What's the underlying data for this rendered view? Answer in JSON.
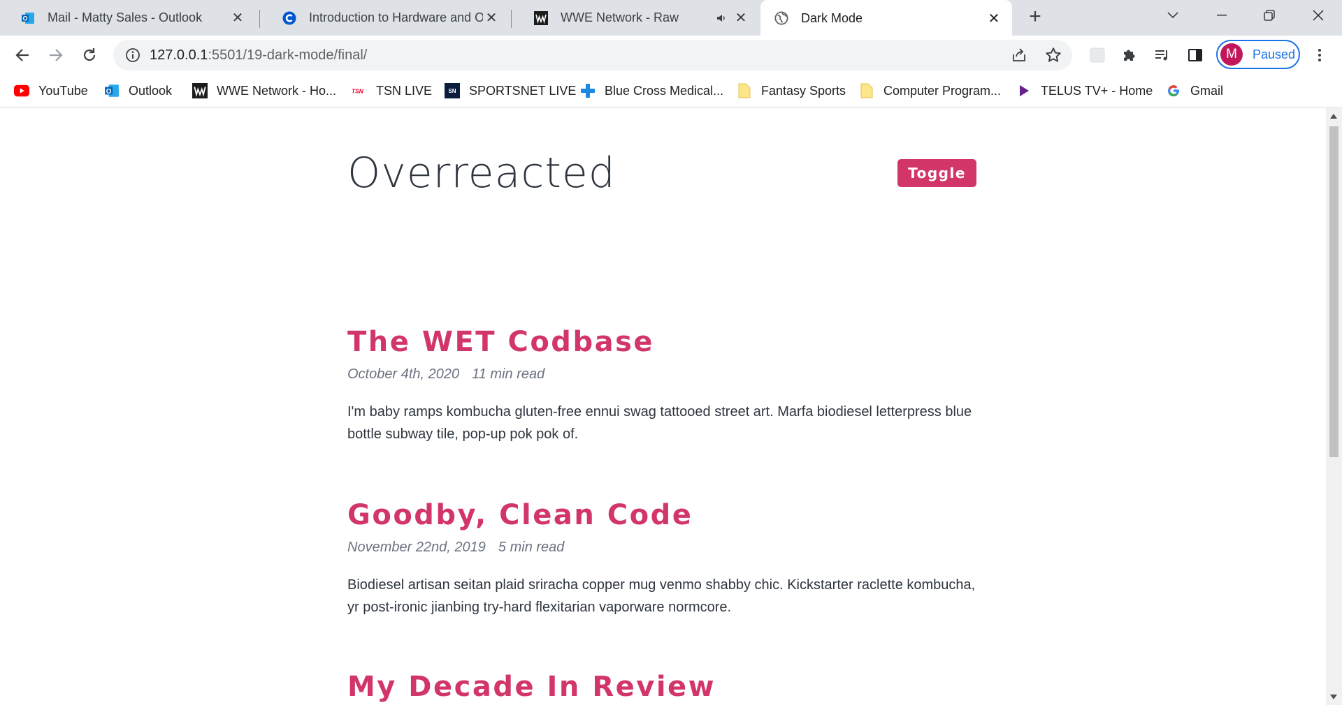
{
  "tabs": [
    {
      "title": "Mail - Matty Sales - Outlook",
      "icon": "outlook-icon"
    },
    {
      "title": "Introduction to Hardware and Op",
      "icon": "coursera-icon"
    },
    {
      "title": "WWE Network - Raw",
      "icon": "wwe-icon",
      "audio": true
    },
    {
      "title": "Dark Mode",
      "icon": "globe-icon",
      "active": true
    }
  ],
  "address_bar": {
    "host": "127.0.0.1",
    "path": ":5501/19-dark-mode/final/"
  },
  "profile": {
    "initial": "M",
    "status": "Paused"
  },
  "bookmarks": [
    {
      "label": "YouTube",
      "icon": "youtube-icon"
    },
    {
      "label": "Outlook",
      "icon": "outlook-icon"
    },
    {
      "label": "WWE Network - Ho...",
      "icon": "wwe-icon"
    },
    {
      "label": "TSN LIVE",
      "icon": "tsn-icon"
    },
    {
      "label": "SPORTSNET LIVE",
      "icon": "sportsnet-icon"
    },
    {
      "label": "Blue Cross Medical...",
      "icon": "blue-cross-icon"
    },
    {
      "label": "Fantasy Sports",
      "icon": "folder-icon"
    },
    {
      "label": "Computer Program...",
      "icon": "folder-icon"
    },
    {
      "label": "TELUS TV+ - Home",
      "icon": "telus-icon"
    },
    {
      "label": "Gmail",
      "icon": "google-icon"
    }
  ],
  "page": {
    "site_title": "Overreacted",
    "toggle_label": "Toggle",
    "accent_color": "#d23669",
    "posts": [
      {
        "title": "The WET Codbase",
        "date": "October 4th, 2020",
        "read_time": "11 min read",
        "excerpt": "I'm baby ramps kombucha gluten-free ennui swag tattooed street art. Marfa biodiesel letterpress blue bottle subway tile, pop-up pok pok of."
      },
      {
        "title": "Goodby, Clean Code",
        "date": "November 22nd, 2019",
        "read_time": "5 min read",
        "excerpt": "Biodiesel artisan seitan plaid sriracha copper mug venmo shabby chic. Kickstarter raclette kombucha, yr post-ironic jianbing try-hard flexitarian vaporware normcore."
      },
      {
        "title": "My Decade In Review"
      }
    ]
  }
}
